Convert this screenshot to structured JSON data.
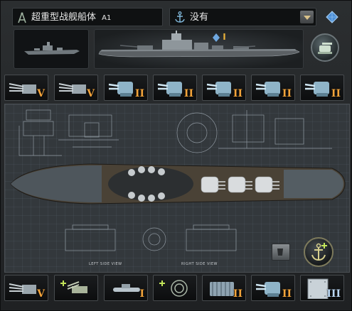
{
  "hull": {
    "name": "超重型战舰船体",
    "suffix": "A1"
  },
  "module": {
    "selected": "没有"
  },
  "preview": {
    "upgrade_level": "I"
  },
  "top_slots": [
    {
      "name": "heavy-guns",
      "level": "V",
      "color": "orange"
    },
    {
      "name": "heavy-guns",
      "level": "V",
      "color": "orange"
    },
    {
      "name": "aa-turret",
      "level": "II",
      "color": "orange"
    },
    {
      "name": "aa-turret",
      "level": "II",
      "color": "orange"
    },
    {
      "name": "aa-turret",
      "level": "II",
      "color": "orange"
    },
    {
      "name": "aa-turret",
      "level": "II",
      "color": "orange"
    },
    {
      "name": "aa-turret",
      "level": "II",
      "color": "orange"
    }
  ],
  "bottom_slots": [
    {
      "name": "heavy-guns",
      "level": "V",
      "color": "orange"
    },
    {
      "name": "add-aa-gun",
      "level": "",
      "color": "orange"
    },
    {
      "name": "torpedo",
      "level": "I",
      "color": "orange"
    },
    {
      "name": "add-radar",
      "level": "",
      "color": "orange"
    },
    {
      "name": "engine",
      "level": "II",
      "color": "orange"
    },
    {
      "name": "aa-turret",
      "level": "II",
      "color": "orange"
    },
    {
      "name": "armor-plate",
      "level": "III",
      "color": "blue"
    }
  ],
  "blueprint": {
    "left_label": "LEFT SIDE VIEW",
    "right_label": "RIGHT SIDE VIEW"
  },
  "colors": {
    "accent_orange": "#f2a33a",
    "deck": "#4a4236",
    "blueprint_bg": "#33383c"
  }
}
